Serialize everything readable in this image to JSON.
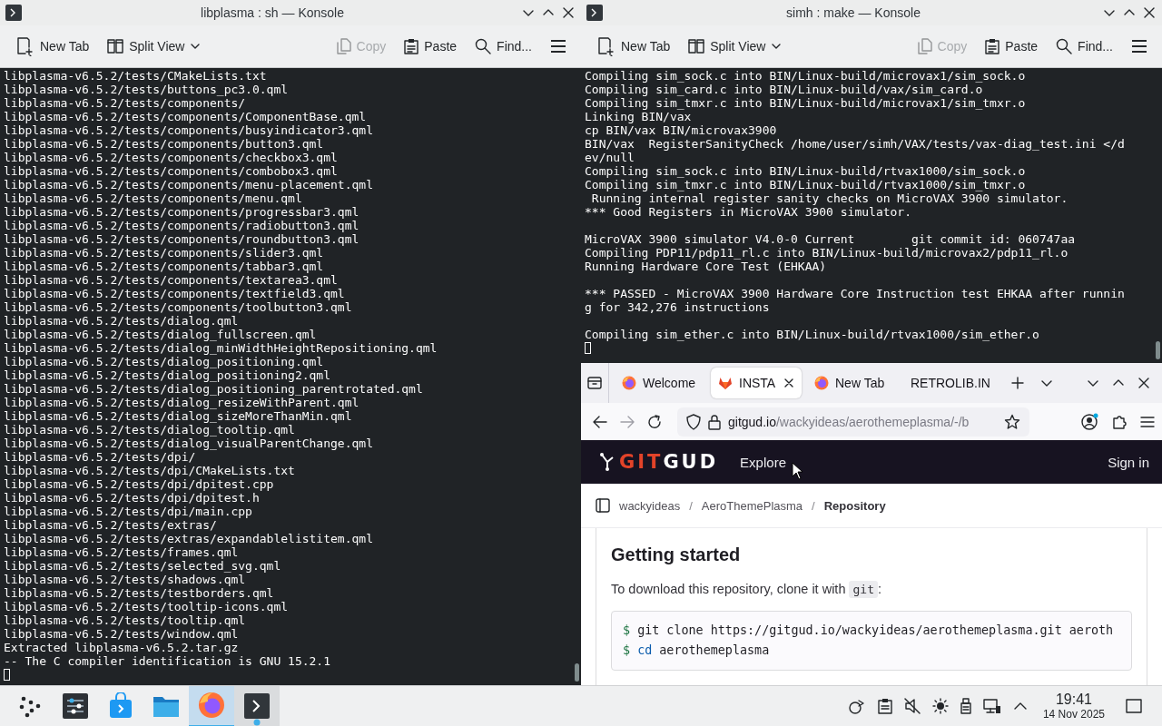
{
  "left_konsole": {
    "title": "libplasma : sh — Konsole",
    "toolbar": [
      {
        "kind": "new-tab",
        "label": "New Tab",
        "disabled": false
      },
      {
        "kind": "split",
        "label": "Split View",
        "disabled": false
      },
      {
        "kind": "copy",
        "label": "Copy",
        "disabled": true
      },
      {
        "kind": "paste",
        "label": "Paste",
        "disabled": false
      },
      {
        "kind": "find",
        "label": "Find...",
        "disabled": false
      },
      {
        "kind": "menu",
        "disabled": false
      }
    ],
    "lines": [
      {
        "kind": "text",
        "text": "libplasma-v6.5.2/tests/CMakeLists.txt"
      },
      {
        "kind": "text",
        "text": "libplasma-v6.5.2/tests/buttons_pc3.0.qml"
      },
      {
        "kind": "text",
        "text": "libplasma-v6.5.2/tests/components/"
      },
      {
        "kind": "text",
        "text": "libplasma-v6.5.2/tests/components/ComponentBase.qml"
      },
      {
        "kind": "text",
        "text": "libplasma-v6.5.2/tests/components/busyindicator3.qml"
      },
      {
        "kind": "text",
        "text": "libplasma-v6.5.2/tests/components/button3.qml"
      },
      {
        "kind": "text",
        "text": "libplasma-v6.5.2/tests/components/checkbox3.qml"
      },
      {
        "kind": "text",
        "text": "libplasma-v6.5.2/tests/components/combobox3.qml"
      },
      {
        "kind": "text",
        "text": "libplasma-v6.5.2/tests/components/menu-placement.qml"
      },
      {
        "kind": "text",
        "text": "libplasma-v6.5.2/tests/components/menu.qml"
      },
      {
        "kind": "text",
        "text": "libplasma-v6.5.2/tests/components/progressbar3.qml"
      },
      {
        "kind": "text",
        "text": "libplasma-v6.5.2/tests/components/radiobutton3.qml"
      },
      {
        "kind": "text",
        "text": "libplasma-v6.5.2/tests/components/roundbutton3.qml"
      },
      {
        "kind": "text",
        "text": "libplasma-v6.5.2/tests/components/slider3.qml"
      },
      {
        "kind": "text",
        "text": "libplasma-v6.5.2/tests/components/tabbar3.qml"
      },
      {
        "kind": "text",
        "text": "libplasma-v6.5.2/tests/components/textarea3.qml"
      },
      {
        "kind": "text",
        "text": "libplasma-v6.5.2/tests/components/textfield3.qml"
      },
      {
        "kind": "text",
        "text": "libplasma-v6.5.2/tests/components/toolbutton3.qml"
      },
      {
        "kind": "text",
        "text": "libplasma-v6.5.2/tests/dialog.qml"
      },
      {
        "kind": "text",
        "text": "libplasma-v6.5.2/tests/dialog_fullscreen.qml"
      },
      {
        "kind": "text",
        "text": "libplasma-v6.5.2/tests/dialog_minWidthHeightRepositioning.qml"
      },
      {
        "kind": "text",
        "text": "libplasma-v6.5.2/tests/dialog_positioning.qml"
      },
      {
        "kind": "text",
        "text": "libplasma-v6.5.2/tests/dialog_positioning2.qml"
      },
      {
        "kind": "text",
        "text": "libplasma-v6.5.2/tests/dialog_positioning_parentrotated.qml"
      },
      {
        "kind": "text",
        "text": "libplasma-v6.5.2/tests/dialog_resizeWithParent.qml"
      },
      {
        "kind": "text",
        "text": "libplasma-v6.5.2/tests/dialog_sizeMoreThanMin.qml"
      },
      {
        "kind": "text",
        "text": "libplasma-v6.5.2/tests/dialog_tooltip.qml"
      },
      {
        "kind": "text",
        "text": "libplasma-v6.5.2/tests/dialog_visualParentChange.qml"
      },
      {
        "kind": "text",
        "text": "libplasma-v6.5.2/tests/dpi/"
      },
      {
        "kind": "text",
        "text": "libplasma-v6.5.2/tests/dpi/CMakeLists.txt"
      },
      {
        "kind": "text",
        "text": "libplasma-v6.5.2/tests/dpi/dpitest.cpp"
      },
      {
        "kind": "text",
        "text": "libplasma-v6.5.2/tests/dpi/dpitest.h"
      },
      {
        "kind": "text",
        "text": "libplasma-v6.5.2/tests/dpi/main.cpp"
      },
      {
        "kind": "text",
        "text": "libplasma-v6.5.2/tests/extras/"
      },
      {
        "kind": "text",
        "text": "libplasma-v6.5.2/tests/extras/expandablelistitem.qml"
      },
      {
        "kind": "text",
        "text": "libplasma-v6.5.2/tests/frames.qml"
      },
      {
        "kind": "text",
        "text": "libplasma-v6.5.2/tests/selected_svg.qml"
      },
      {
        "kind": "text",
        "text": "libplasma-v6.5.2/tests/shadows.qml"
      },
      {
        "kind": "text",
        "text": "libplasma-v6.5.2/tests/testborders.qml"
      },
      {
        "kind": "text",
        "text": "libplasma-v6.5.2/tests/tooltip-icons.qml"
      },
      {
        "kind": "text",
        "text": "libplasma-v6.5.2/tests/tooltip.qml"
      },
      {
        "kind": "text",
        "text": "libplasma-v6.5.2/tests/window.qml"
      },
      {
        "kind": "text",
        "text": "Extracted libplasma-v6.5.2.tar.gz"
      },
      {
        "kind": "text",
        "text": "-- The C compiler identification is GNU 15.2.1"
      },
      {
        "kind": "cursor"
      }
    ]
  },
  "right_konsole": {
    "title": "simh : make — Konsole",
    "toolbar": [
      {
        "kind": "new-tab",
        "label": "New Tab",
        "disabled": false
      },
      {
        "kind": "split",
        "label": "Split View",
        "disabled": false
      },
      {
        "kind": "copy",
        "label": "Copy",
        "disabled": true
      },
      {
        "kind": "paste",
        "label": "Paste",
        "disabled": false
      },
      {
        "kind": "find",
        "label": "Find...",
        "disabled": false
      },
      {
        "kind": "menu",
        "disabled": false
      }
    ],
    "lines": [
      {
        "kind": "text",
        "text": "Compiling sim_sock.c into BIN/Linux-build/microvax1/sim_sock.o"
      },
      {
        "kind": "text",
        "text": "Compiling sim_card.c into BIN/Linux-build/vax/sim_card.o"
      },
      {
        "kind": "text",
        "text": "Compiling sim_tmxr.c into BIN/Linux-build/microvax1/sim_tmxr.o"
      },
      {
        "kind": "text",
        "text": "Linking BIN/vax"
      },
      {
        "kind": "text",
        "text": "cp BIN/vax BIN/microvax3900"
      },
      {
        "kind": "text",
        "text": "BIN/vax  RegisterSanityCheck /home/user/simh/VAX/tests/vax-diag_test.ini </d"
      },
      {
        "kind": "text",
        "text": "ev/null"
      },
      {
        "kind": "text",
        "text": "Compiling sim_sock.c into BIN/Linux-build/rtvax1000/sim_sock.o"
      },
      {
        "kind": "text",
        "text": "Compiling sim_tmxr.c into BIN/Linux-build/rtvax1000/sim_tmxr.o"
      },
      {
        "kind": "text",
        "text": " Running internal register sanity checks on MicroVAX 3900 simulator."
      },
      {
        "kind": "text",
        "text": "*** Good Registers in MicroVAX 3900 simulator."
      },
      {
        "kind": "blank"
      },
      {
        "kind": "text",
        "text": "MicroVAX 3900 simulator V4.0-0 Current        git commit id: 060747aa"
      },
      {
        "kind": "text",
        "text": "Compiling PDP11/pdp11_rl.c into BIN/Linux-build/microvax2/pdp11_rl.o"
      },
      {
        "kind": "text",
        "text": "Running Hardware Core Test (EHKAA)"
      },
      {
        "kind": "blank"
      },
      {
        "kind": "text",
        "text": "*** PASSED - MicroVAX 3900 Hardware Core Instruction test EHKAA after runnin"
      },
      {
        "kind": "text",
        "text": "g for 342,276 instructions"
      },
      {
        "kind": "blank"
      },
      {
        "kind": "text",
        "text": "Compiling sim_ether.c into BIN/Linux-build/rtvax1000/sim_ether.o"
      },
      {
        "kind": "cursor"
      }
    ]
  },
  "browser": {
    "tabs": [
      {
        "label": "Welcome",
        "kind": "firefox",
        "selected": false
      },
      {
        "label": "INSTA",
        "kind": "fox",
        "selected": true
      },
      {
        "label": "New Tab",
        "kind": "firefox",
        "selected": false
      },
      {
        "label": "RETROLIB.IN",
        "kind": "plain",
        "selected": false
      }
    ],
    "url": {
      "host": "gitgud.io",
      "path": "/wackyideas/aerothemeplasma/-/b"
    },
    "site": {
      "logo": {
        "accent": "GIT",
        "rest": "GUD"
      },
      "nav": "Explore",
      "sign_in": "Sign in"
    },
    "breadcrumb_separator": "/",
    "breadcrumb": [
      {
        "label": "wackyideas",
        "current": false
      },
      {
        "label": "AeroThemePlasma",
        "current": false
      },
      {
        "label": "Repository",
        "current": true
      }
    ],
    "heading": "Getting started",
    "intro": {
      "before": "To download this repository, clone it with",
      "code": "git",
      "after": ":"
    },
    "code_lines": [
      {
        "prompt": "$",
        "parts": [
          {
            "kind": "plain",
            "text": "git clone https://gitgud.io/wackyideas/aerothemeplasma.git aeroth"
          }
        ]
      },
      {
        "prompt": "$",
        "parts": [
          {
            "kind": "builtin",
            "text": "cd"
          },
          {
            "kind": "plain",
            "text": "aerothemeplasma"
          }
        ]
      }
    ]
  },
  "taskbar": {
    "apps": [
      {
        "kind": "launcher",
        "active": false,
        "running": false
      },
      {
        "kind": "settings",
        "active": false,
        "running": false
      },
      {
        "kind": "discover",
        "active": false,
        "running": false
      },
      {
        "kind": "files",
        "active": false,
        "running": false
      },
      {
        "kind": "firefox",
        "active": true,
        "running": true
      },
      {
        "kind": "konsole",
        "active": false,
        "running": true
      }
    ],
    "time": "19:41",
    "date": "14 Nov 2025"
  }
}
